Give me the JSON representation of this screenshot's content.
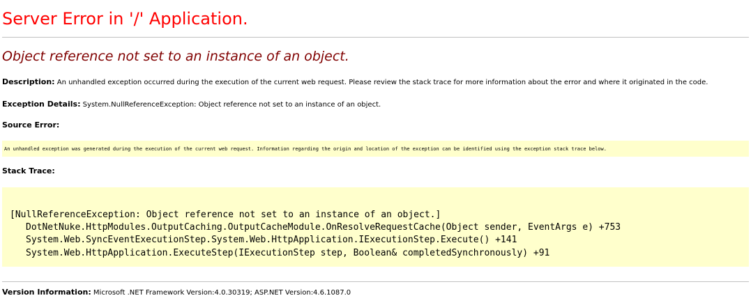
{
  "header": {
    "title": "Server Error in '/' Application.",
    "subtitle": "Object reference not set to an instance of an object."
  },
  "description": {
    "label": "Description:",
    "text": "An unhandled exception occurred during the execution of the current web request. Please review the stack trace for more information about the error and where it originated in the code."
  },
  "exception_details": {
    "label": "Exception Details:",
    "text": "System.NullReferenceException: Object reference not set to an instance of an object."
  },
  "source_error": {
    "label": "Source Error:",
    "text": "An unhandled exception was generated during the execution of the current web request. Information regarding the origin and location of the exception can be identified using the exception stack trace below."
  },
  "stack_trace": {
    "label": "Stack Trace:",
    "lines": [
      "[NullReferenceException: Object reference not set to an instance of an object.]",
      "DotNetNuke.HttpModules.OutputCaching.OutputCacheModule.OnResolveRequestCache(Object sender, EventArgs e) +753",
      "System.Web.SyncEventExecutionStep.System.Web.HttpApplication.IExecutionStep.Execute() +141",
      "System.Web.HttpApplication.ExecuteStep(IExecutionStep step, Boolean& completedSynchronously) +91"
    ]
  },
  "version_information": {
    "label": "Version Information:",
    "text": "Microsoft .NET Framework Version:4.0.30319; ASP.NET Version:4.6.1087.0"
  },
  "colors": {
    "title": "#ff0000",
    "subtitle": "#800000",
    "code_background": "#ffffcc",
    "rule": "#c0c0c0"
  }
}
